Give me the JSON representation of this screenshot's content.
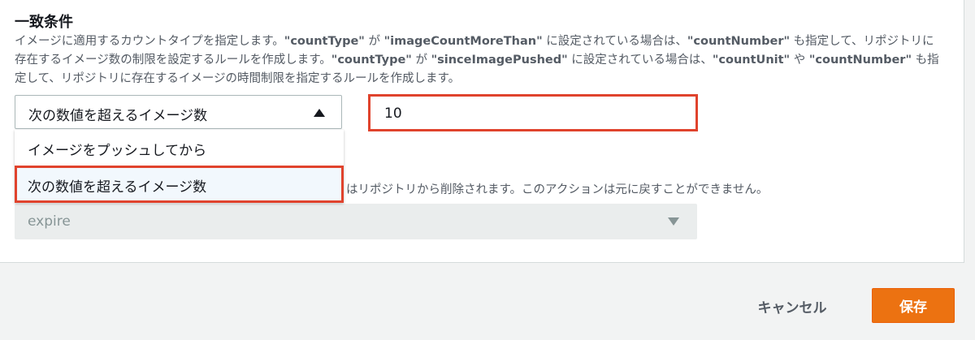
{
  "section": {
    "title": "一致条件",
    "description": {
      "p1": "イメージに適用するカウントタイプを指定します。",
      "k1": "\"countType\"",
      "p2": " が ",
      "k2": "\"imageCountMoreThan\"",
      "p3": " に設定されている場合は、",
      "k3": "\"countNumber\"",
      "p4": " も指定して、リポジトリに存在するイメージ数の制限を設定するルールを作成します。",
      "k4": "\"countType\"",
      "p5": " が ",
      "k5": "\"sinceImagePushed\"",
      "p6": " に設定されている場合は、",
      "k6": "\"countUnit\"",
      "p7": " や ",
      "k7": "\"countNumber\"",
      "p8": " も指定して、リポジトリに存在するイメージの時間制限を指定するルールを作成します。"
    }
  },
  "count_type_select": {
    "selected": "次の数値を超えるイメージ数",
    "options": [
      "イメージをプッシュしてから",
      "次の数値を超えるイメージ数"
    ]
  },
  "count_number_input": {
    "value": "10"
  },
  "action": {
    "description_partial": "はリポジトリから削除されます。このアクションは元に戻すことができません。",
    "selected": "expire"
  },
  "footer": {
    "cancel_label": "キャンセル",
    "save_label": "保存"
  },
  "colors": {
    "highlight_border": "#e0432d",
    "primary_button": "#ec7211",
    "selected_option_bg": "#f2f8fd"
  },
  "icons": {
    "select_open": "caret-up-icon",
    "select_closed": "caret-down-icon"
  }
}
